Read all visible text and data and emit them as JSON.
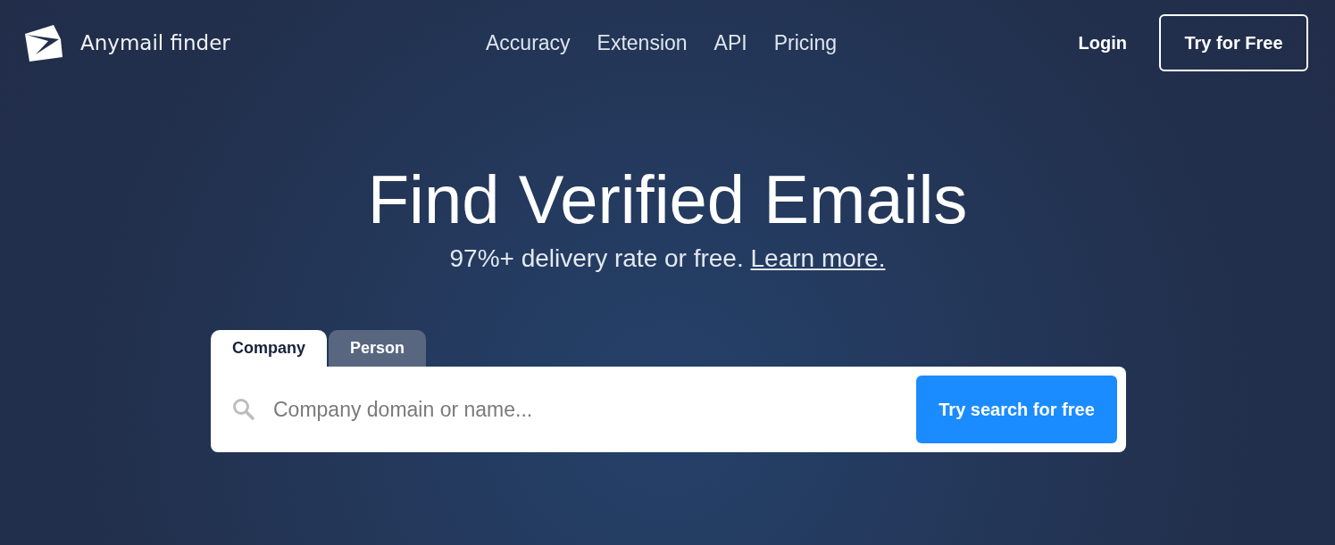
{
  "header": {
    "brand": "Anymail finder",
    "nav": [
      "Accuracy",
      "Extension",
      "API",
      "Pricing"
    ],
    "login": "Login",
    "cta": "Try for Free"
  },
  "hero": {
    "title": "Find Verified Emails",
    "subtitle": "97%+ delivery rate or free.",
    "link": "Learn more."
  },
  "search": {
    "tabs": [
      {
        "label": "Company",
        "selected": true
      },
      {
        "label": "Person",
        "selected": false
      }
    ],
    "placeholder": "Company domain or name...",
    "button": "Try search for free"
  }
}
